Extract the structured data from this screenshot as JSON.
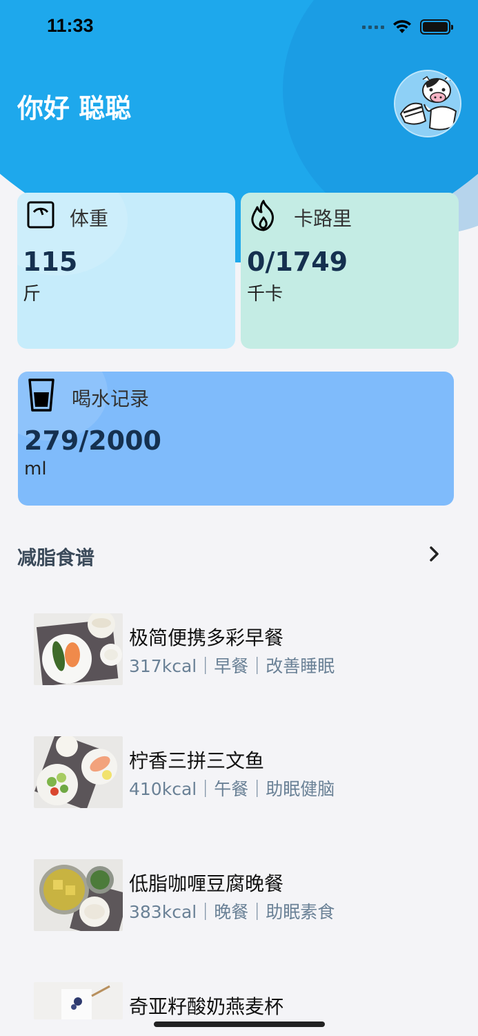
{
  "status_bar": {
    "time": "11:33"
  },
  "header": {
    "greeting": "你好 聪聪"
  },
  "colors": {
    "header_blue": "#1ea8ec",
    "weight_card": "#c6ecfb",
    "calorie_card": "#c4ece4",
    "water_card": "#7fbbfb",
    "value_text": "#15304f",
    "meta_text": "#6a8196"
  },
  "cards": {
    "weight": {
      "icon": "scale-icon",
      "title": "体重",
      "value": "115",
      "unit": "斤"
    },
    "calorie": {
      "icon": "flame-icon",
      "title": "卡路里",
      "value": "0/1749",
      "unit": "千卡"
    },
    "water": {
      "icon": "cup-icon",
      "title": "喝水记录",
      "value": "279/2000",
      "unit": "ml"
    }
  },
  "recipes_section": {
    "title": "减脂食谱",
    "more_icon": "chevron-right-icon",
    "items": [
      {
        "name": "极简便携多彩早餐",
        "meta": "317kcal｜早餐｜改善睡眠"
      },
      {
        "name": "柠香三拼三文鱼",
        "meta": "410kcal｜午餐｜助眠健脑"
      },
      {
        "name": "低脂咖喱豆腐晚餐",
        "meta": "383kcal｜晚餐｜助眠素食"
      },
      {
        "name": "奇亚籽酸奶燕麦杯",
        "meta": ""
      }
    ]
  }
}
